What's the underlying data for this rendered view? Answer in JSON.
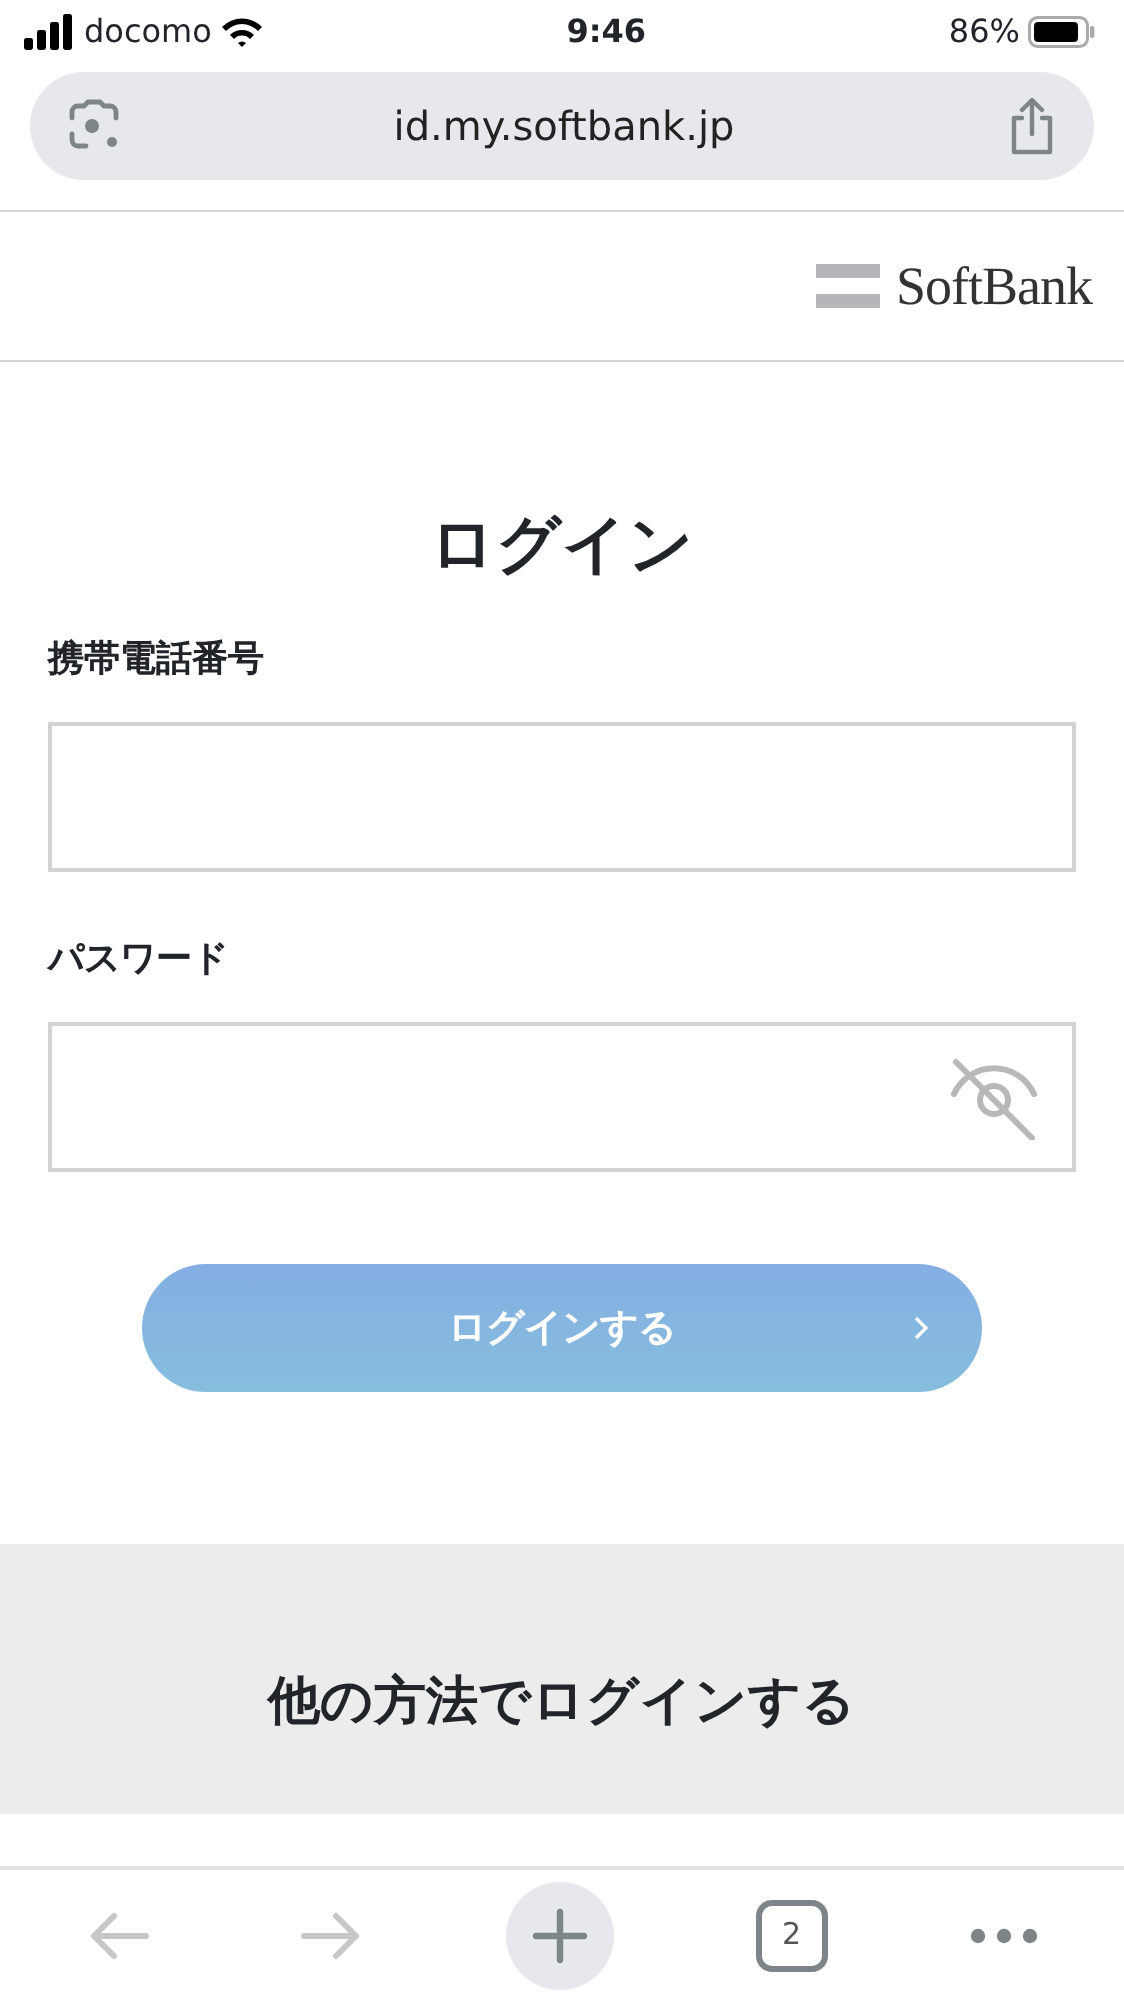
{
  "status_bar": {
    "carrier": "docomo",
    "time": "9:46",
    "battery": "86%"
  },
  "url_bar": {
    "url": "id.my.softbank.jp"
  },
  "logo": {
    "text": "SoftBank"
  },
  "heading": "ログイン",
  "fields": [
    {
      "label": "携帯電話番号",
      "kind": "text"
    },
    {
      "label": "パスワード",
      "kind": "password"
    }
  ],
  "login_button": {
    "label": "ログインする"
  },
  "other_section": {
    "heading": "他の方法でログインする"
  },
  "toolbar": {
    "back": {
      "disabled": true
    },
    "forward": {
      "disabled": true
    },
    "tab_count": "2"
  }
}
